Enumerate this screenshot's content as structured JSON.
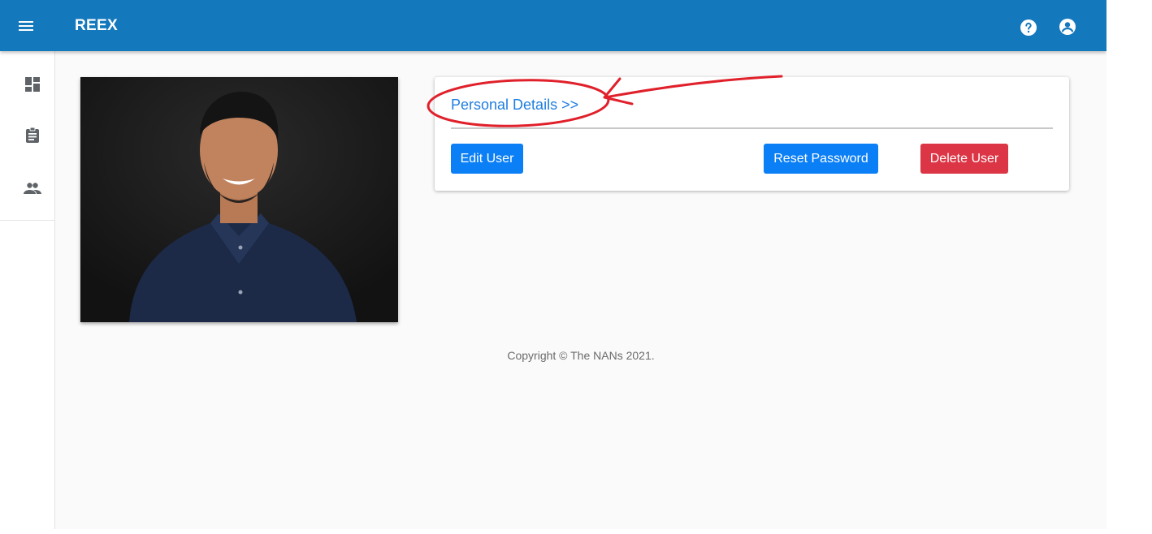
{
  "appbar": {
    "title": "REEX",
    "icons": [
      "menu-icon",
      "help-icon",
      "account-circle-icon"
    ]
  },
  "drawer": {
    "items": [
      {
        "icon": "dashboard-icon"
      },
      {
        "icon": "assignment-icon"
      },
      {
        "icon": "people-icon"
      }
    ]
  },
  "profile": {
    "photo_alt": "User profile photo"
  },
  "card": {
    "title": "Personal Details >>",
    "edit_label": "Edit User",
    "reset_label": "Reset Password",
    "delete_label": "Delete User"
  },
  "footer": {
    "copyright": "Copyright © The NANs 2021."
  },
  "colors": {
    "appbar": "#1478bd",
    "primary_button": "#0b7ff5",
    "danger_button": "#dc3545",
    "link": "#1f7ee0",
    "annotation": "#e0202a"
  }
}
